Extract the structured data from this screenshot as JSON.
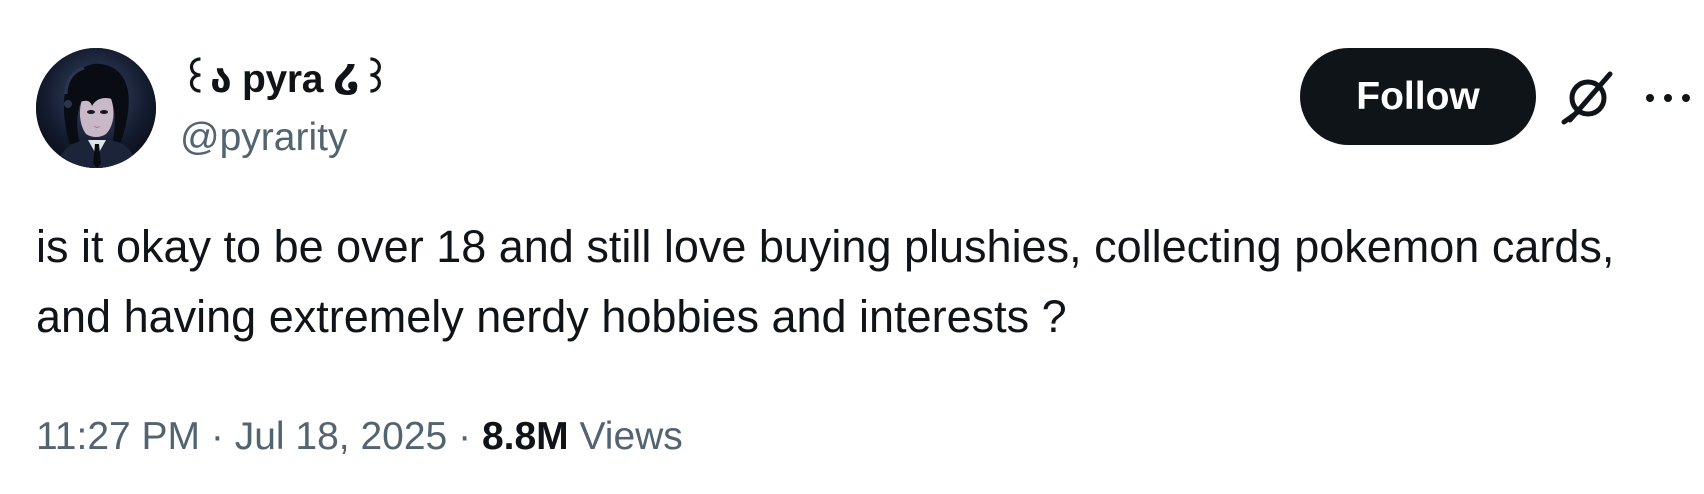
{
  "author": {
    "display_name": "꒰ა pyra ໒꒱",
    "handle": "@pyrarity"
  },
  "actions": {
    "follow_label": "Follow",
    "grok_icon": "grok-icon",
    "more_icon": "more-horizontal-icon"
  },
  "tweet": {
    "text": "is it okay to be over 18 and still love buying plushies, collecting pokemon cards, and having extremely nerdy hobbies and interests ?"
  },
  "meta": {
    "time": "11:27 PM",
    "separator": "·",
    "date": "Jul 18, 2025",
    "views_count": "8.8M",
    "views_label": "Views"
  },
  "colors": {
    "text_primary": "#0f1419",
    "text_secondary": "#536471",
    "follow_bg": "#0f1419",
    "follow_text": "#ffffff"
  }
}
